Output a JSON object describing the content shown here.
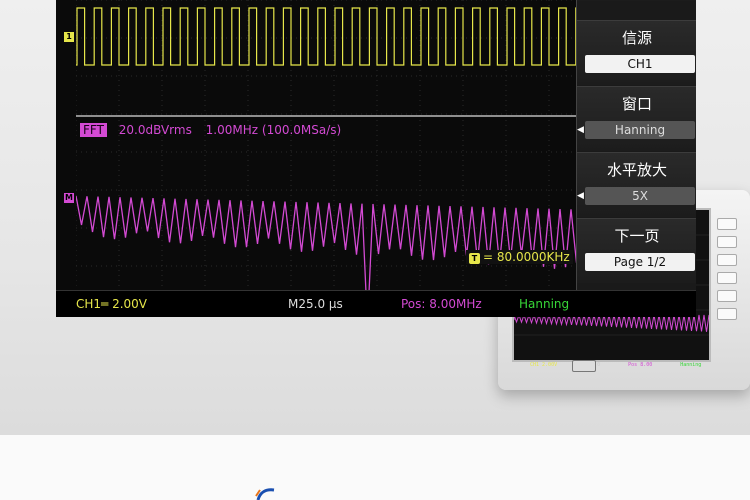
{
  "scope": {
    "fft": {
      "tag": "FFT",
      "scale": "20.0dBVrms",
      "rate": "1.00MHz (100.0MSa/s)"
    },
    "channel_marker": "1",
    "math_marker": "M",
    "cursor_tag": "T",
    "cursor_readout": "= 80.0000KHz",
    "status": {
      "ch1": "CH1═ 2.00V",
      "timebase": "M25.0 μs",
      "pos": "Pos: 8.00MHz",
      "window": "Hanning"
    },
    "menu": [
      {
        "title": "信源",
        "value": "CH1",
        "selected": true
      },
      {
        "title": "窗口",
        "value": "Hanning",
        "selected": false
      },
      {
        "title": "水平放大",
        "value": "5X",
        "selected": false
      },
      {
        "title": "下一页",
        "value": "Page 1/2",
        "selected": true
      }
    ]
  },
  "device": {
    "status": [
      "CH1 2.00V",
      "M25.0",
      "Pos 8.00",
      "Hanning"
    ],
    "menu": [
      "信源",
      "窗口",
      "水平放大",
      "下一页"
    ],
    "page": "Page 1/2"
  },
  "colors": {
    "ch1": "#e6e64a",
    "math": "#d34ad3",
    "pos": "#d34ad3",
    "window": "#37d637"
  }
}
